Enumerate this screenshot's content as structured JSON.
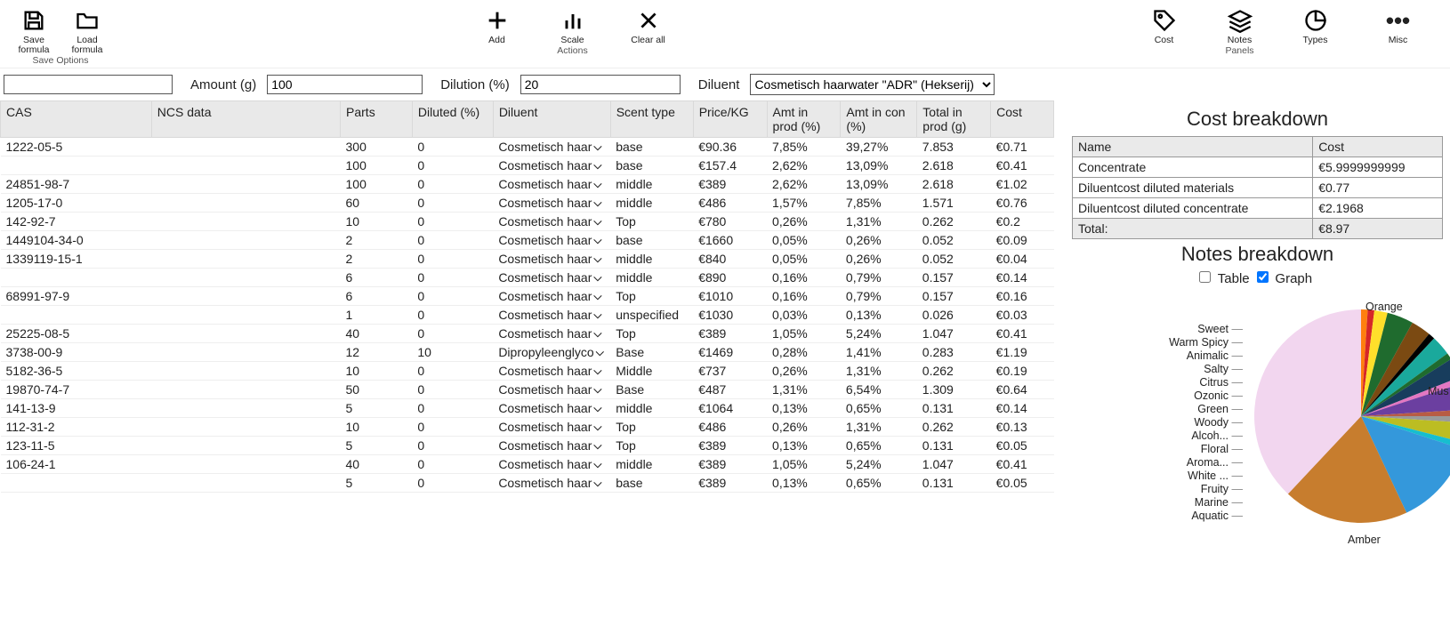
{
  "toolbar": {
    "save_formula": "Save\nformula",
    "load_formula": "Load\nformula",
    "save_options_group": "Save Options",
    "add": "Add",
    "scale": "Scale",
    "clear_all": "Clear all",
    "actions_group": "Actions",
    "cost": "Cost",
    "notes": "Notes",
    "types": "Types",
    "panels_group": "Panels",
    "misc": "Misc"
  },
  "inputs": {
    "amount_lbl": "Amount (g)",
    "amount_val": "100",
    "dilution_lbl": "Dilution (%)",
    "dilution_val": "20",
    "diluent_lbl": "Diluent",
    "diluent_selected": "Cosmetisch haarwater \"ADR\" (Hekserij)"
  },
  "columns": {
    "cas": "CAS",
    "ncs": "NCS data",
    "parts": "Parts",
    "diluted": "Diluted (%)",
    "diluent": "Diluent",
    "scent": "Scent type",
    "price": "Price/KG",
    "amt_prod": "Amt in prod (%)",
    "amt_con": "Amt in con (%)",
    "total_prod": "Total in prod (g)",
    "cost": "Cost"
  },
  "diluent_short": "Cosmetisch haar",
  "diluent_alt": "Dipropyleenglyco",
  "rows": [
    {
      "cas": "1222-05-5",
      "parts": "300",
      "dil": "0",
      "diluent": "std",
      "scent": "base",
      "price": "€90.36",
      "ap": "7,85%",
      "ac": "39,27%",
      "tp": "7.853",
      "cost": "€0.71"
    },
    {
      "cas": "",
      "parts": "100",
      "dil": "0",
      "diluent": "std",
      "scent": "base",
      "price": "€157.4",
      "ap": "2,62%",
      "ac": "13,09%",
      "tp": "2.618",
      "cost": "€0.41"
    },
    {
      "cas": "24851-98-7",
      "parts": "100",
      "dil": "0",
      "diluent": "std",
      "scent": "middle",
      "price": "€389",
      "ap": "2,62%",
      "ac": "13,09%",
      "tp": "2.618",
      "cost": "€1.02"
    },
    {
      "cas": "1205-17-0",
      "parts": "60",
      "dil": "0",
      "diluent": "std",
      "scent": "middle",
      "price": "€486",
      "ap": "1,57%",
      "ac": "7,85%",
      "tp": "1.571",
      "cost": "€0.76"
    },
    {
      "cas": "142-92-7",
      "parts": "10",
      "dil": "0",
      "diluent": "std",
      "scent": "Top",
      "price": "€780",
      "ap": "0,26%",
      "ac": "1,31%",
      "tp": "0.262",
      "cost": "€0.2"
    },
    {
      "cas": "1449104-34-0",
      "parts": "2",
      "dil": "0",
      "diluent": "std",
      "scent": "base",
      "price": "€1660",
      "ap": "0,05%",
      "ac": "0,26%",
      "tp": "0.052",
      "cost": "€0.09"
    },
    {
      "cas": "1339119-15-1",
      "parts": "2",
      "dil": "0",
      "diluent": "std",
      "scent": "middle",
      "price": "€840",
      "ap": "0,05%",
      "ac": "0,26%",
      "tp": "0.052",
      "cost": "€0.04"
    },
    {
      "cas": "",
      "parts": "6",
      "dil": "0",
      "diluent": "std",
      "scent": "middle",
      "price": "€890",
      "ap": "0,16%",
      "ac": "0,79%",
      "tp": "0.157",
      "cost": "€0.14"
    },
    {
      "cas": "68991-97-9",
      "parts": "6",
      "dil": "0",
      "diluent": "std",
      "scent": "Top",
      "price": "€1010",
      "ap": "0,16%",
      "ac": "0,79%",
      "tp": "0.157",
      "cost": "€0.16"
    },
    {
      "cas": "",
      "parts": "1",
      "dil": "0",
      "diluent": "std",
      "scent": "unspecified",
      "price": "€1030",
      "ap": "0,03%",
      "ac": "0,13%",
      "tp": "0.026",
      "cost": "€0.03"
    },
    {
      "cas": "25225-08-5",
      "parts": "40",
      "dil": "0",
      "diluent": "std",
      "scent": "Top",
      "price": "€389",
      "ap": "1,05%",
      "ac": "5,24%",
      "tp": "1.047",
      "cost": "€0.41"
    },
    {
      "cas": "3738-00-9",
      "parts": "12",
      "dil": "10",
      "diluent": "alt",
      "scent": "Base",
      "price": "€1469",
      "ap": "0,28%",
      "ac": "1,41%",
      "tp": "0.283",
      "cost": "€1.19"
    },
    {
      "cas": "5182-36-5",
      "parts": "10",
      "dil": "0",
      "diluent": "std",
      "scent": "Middle",
      "price": "€737",
      "ap": "0,26%",
      "ac": "1,31%",
      "tp": "0.262",
      "cost": "€0.19"
    },
    {
      "cas": "19870-74-7",
      "parts": "50",
      "dil": "0",
      "diluent": "std",
      "scent": "Base",
      "price": "€487",
      "ap": "1,31%",
      "ac": "6,54%",
      "tp": "1.309",
      "cost": "€0.64"
    },
    {
      "cas": "141-13-9",
      "parts": "5",
      "dil": "0",
      "diluent": "std",
      "scent": "middle",
      "price": "€1064",
      "ap": "0,13%",
      "ac": "0,65%",
      "tp": "0.131",
      "cost": "€0.14"
    },
    {
      "cas": "112-31-2",
      "parts": "10",
      "dil": "0",
      "diluent": "std",
      "scent": "Top",
      "price": "€486",
      "ap": "0,26%",
      "ac": "1,31%",
      "tp": "0.262",
      "cost": "€0.13"
    },
    {
      "cas": "123-11-5",
      "parts": "5",
      "dil": "0",
      "diluent": "std",
      "scent": "Top",
      "price": "€389",
      "ap": "0,13%",
      "ac": "0,65%",
      "tp": "0.131",
      "cost": "€0.05"
    },
    {
      "cas": "106-24-1",
      "parts": "40",
      "dil": "0",
      "diluent": "std",
      "scent": "middle",
      "price": "€389",
      "ap": "1,05%",
      "ac": "5,24%",
      "tp": "1.047",
      "cost": "€0.41"
    },
    {
      "cas": "",
      "parts": "5",
      "dil": "0",
      "diluent": "std",
      "scent": "base",
      "price": "€389",
      "ap": "0,13%",
      "ac": "0,65%",
      "tp": "0.131",
      "cost": "€0.05"
    }
  ],
  "cost_panel": {
    "title": "Cost breakdown",
    "h_name": "Name",
    "h_cost": "Cost",
    "rows": [
      {
        "n": "Concentrate",
        "c": "€5.9999999999"
      },
      {
        "n": "Diluentcost diluted materials",
        "c": "€0.77"
      },
      {
        "n": "Diluentcost diluted concentrate",
        "c": "€2.1968"
      }
    ],
    "total_lbl": "Total:",
    "total_val": "€8.97"
  },
  "notes_panel": {
    "title": "Notes breakdown",
    "table_lbl": "Table",
    "graph_lbl": "Graph"
  },
  "chart_data": {
    "type": "pie",
    "series": [
      {
        "name": "Orange",
        "value": 1,
        "color": "#ff7f0e"
      },
      {
        "name": "Sweet",
        "value": 1,
        "color": "#d62728"
      },
      {
        "name": "Warm Spicy",
        "value": 2,
        "color": "#ffdf2b"
      },
      {
        "name": "Animalic",
        "value": 4,
        "color": "#1f6b2e"
      },
      {
        "name": "Salty",
        "value": 3,
        "color": "#7b4a12"
      },
      {
        "name": "Citrus",
        "value": 1,
        "color": "#000000"
      },
      {
        "name": "Ozonic",
        "value": 3,
        "color": "#1aa99c"
      },
      {
        "name": "Green",
        "value": 1,
        "color": "#1f6b2e"
      },
      {
        "name": "Woody",
        "value": 3,
        "color": "#183d5d"
      },
      {
        "name": "Alcoh...",
        "value": 1,
        "color": "#e377c2"
      },
      {
        "name": "Floral",
        "value": 4,
        "color": "#6b3fa0"
      },
      {
        "name": "Aroma...",
        "value": 1,
        "color": "#b85c44"
      },
      {
        "name": "White ...",
        "value": 1,
        "color": "#9a9a9a"
      },
      {
        "name": "Fruity",
        "value": 3,
        "color": "#bcbd22"
      },
      {
        "name": "Marine",
        "value": 1,
        "color": "#17becf"
      },
      {
        "name": "Aquatic",
        "value": 13,
        "color": "#3498db"
      },
      {
        "name": "Amber",
        "value": 19,
        "color": "#c77d2e"
      },
      {
        "name": "Mus",
        "value": 38,
        "color": "#f2d6ef"
      }
    ]
  }
}
